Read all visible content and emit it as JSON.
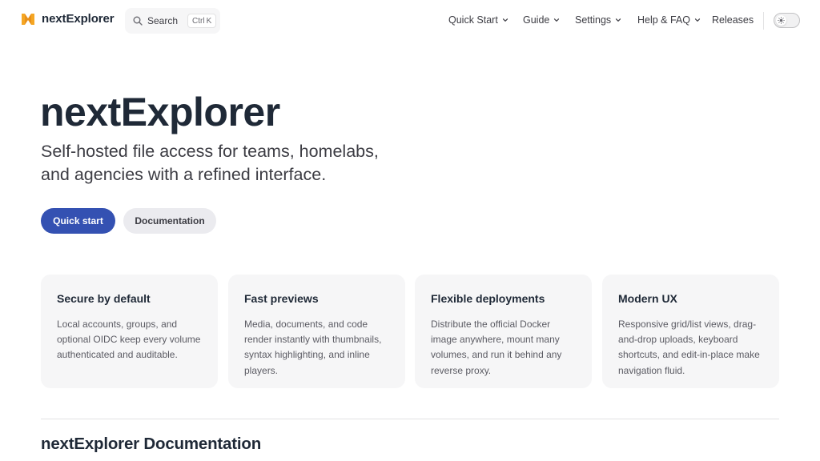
{
  "nav": {
    "brand": "nextExplorer",
    "search_label": "Search",
    "search_kbd_mod": "Ctrl",
    "search_kbd_key": "K",
    "quick_start": "Quick Start",
    "guide": "Guide",
    "settings": "Settings",
    "help": "Help & FAQ",
    "releases": "Releases"
  },
  "hero": {
    "title": "nextExplorer",
    "tagline": "Self-hosted file access for teams, homelabs, and agencies with a refined interface.",
    "primary_button": "Quick start",
    "secondary_button": "Documentation"
  },
  "features": [
    {
      "title": "Secure by default",
      "text": "Local accounts, groups, and optional OIDC keep every volume authenticated and auditable."
    },
    {
      "title": "Fast previews",
      "text": "Media, documents, and code render instantly with thumbnails, syntax highlighting, and inline players."
    },
    {
      "title": "Flexible deployments",
      "text": "Distribute the official Docker image anywhere, mount many volumes, and run it behind any reverse proxy."
    },
    {
      "title": "Modern UX",
      "text": "Responsive grid/list views, drag-and-drop uploads, keyboard shortcuts, and edit-in-place make navigation fluid."
    }
  ],
  "doc_heading": "nextExplorer Documentation",
  "colors": {
    "brand_accent": "#3451b2",
    "logo_orange": "#f5a623",
    "card_bg": "#f6f6f7"
  },
  "icons": [
    "logo-icon",
    "search-icon",
    "chevron-down-icon",
    "sun-icon"
  ]
}
